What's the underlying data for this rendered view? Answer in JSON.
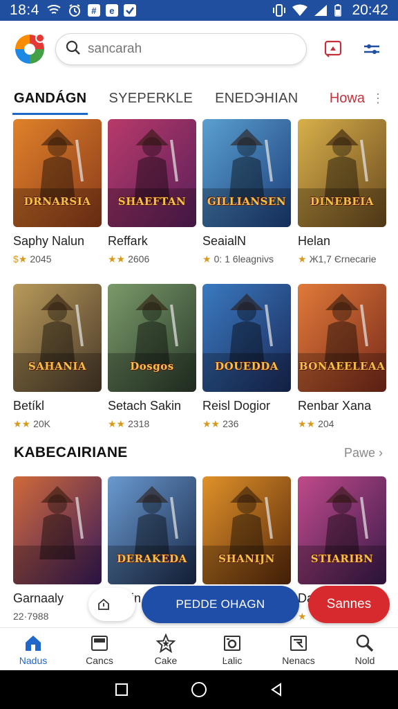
{
  "status_bar": {
    "time_left": "18:4",
    "box_icon_1": "#",
    "box_icon_2": "e",
    "time_right": "20:42"
  },
  "search": {
    "placeholder": "sancarah",
    "value": ""
  },
  "tabs": [
    {
      "label": "GANDÁGN",
      "active": true
    },
    {
      "label": "SYEPERKLE",
      "active": false
    },
    {
      "label": "ENEDЭHIAN",
      "active": false
    }
  ],
  "tab_more": "Howa",
  "grid_rows": [
    [
      {
        "title": "Saphy Nalun",
        "stars": "$★",
        "meta": "2045",
        "art": "DRNARSIA",
        "colors": [
          "#8a3a1a",
          "#e0822a"
        ]
      },
      {
        "title": "Reffark",
        "stars": "★★",
        "meta": "2606",
        "art": "SHAEFTAN",
        "colors": [
          "#5a1f5a",
          "#b83a6a"
        ]
      },
      {
        "title": "SeaialN",
        "stars": "★",
        "meta": "0: 1 6leagnivs",
        "art": "GILLIANSEN",
        "colors": [
          "#1c3e7a",
          "#5aa0d0"
        ]
      },
      {
        "title": "Helan",
        "stars": "★",
        "meta": "Ж1,7 Єrnecarie",
        "art": "DINEBEIA",
        "colors": [
          "#6a4a1f",
          "#d8b04a"
        ]
      }
    ],
    [
      {
        "title": "Betíkl",
        "stars": "★★",
        "meta": "20K",
        "art": "SAHANIA",
        "colors": [
          "#4a3a2a",
          "#b89a5a"
        ]
      },
      {
        "title": "Setach Sakin",
        "stars": "★★",
        "meta": "2318",
        "art": "Dosgos",
        "colors": [
          "#2a3a2a",
          "#7a9a6a"
        ]
      },
      {
        "title": "Reisl Dogior",
        "stars": "★★",
        "meta": "236",
        "art": "DOUEDDA",
        "colors": [
          "#1a2a5a",
          "#3a7ac0"
        ]
      },
      {
        "title": "Renbar Xana",
        "stars": "★★",
        "meta": "204",
        "art": "BONAEELEAA",
        "colors": [
          "#7a2a1a",
          "#e07a3a"
        ]
      }
    ],
    [
      {
        "title": "Garnaaly",
        "stars": "",
        "meta": "22·7988",
        "art": "",
        "colors": [
          "#3a1a5a",
          "#d06a3a"
        ]
      },
      {
        "title": "Oanin",
        "stars": "",
        "meta": "",
        "art": "DERAKEDA",
        "colors": [
          "#1a2a4a",
          "#6a9ad0"
        ]
      },
      {
        "title": "",
        "stars": "",
        "meta": "",
        "art": "SHANIJN",
        "colors": [
          "#5a2a0a",
          "#e0922a"
        ]
      },
      {
        "title": "Dar",
        "stars": "★",
        "meta": "",
        "art": "STIARIBN",
        "colors": [
          "#3a1a4a",
          "#c04a8a"
        ]
      }
    ]
  ],
  "section": {
    "title": "KABECAIRIANE",
    "more": "Pawe"
  },
  "buttons": {
    "primary": "PEDDE OHAGN",
    "secondary": "Sannes"
  },
  "bottom_nav": [
    {
      "label": "Nadus",
      "icon": "home-icon",
      "active": true
    },
    {
      "label": "Cancs",
      "icon": "tablet-icon",
      "active": false
    },
    {
      "label": "Cake",
      "icon": "star-icon",
      "active": false
    },
    {
      "label": "Ŀalic",
      "icon": "camera-icon",
      "active": false
    },
    {
      "label": "Nenacs",
      "icon": "image-icon",
      "active": false
    },
    {
      "label": "Nold",
      "icon": "search-icon",
      "active": false
    }
  ],
  "colors": {
    "status_bar": "#1f4f9e",
    "accent": "#1f67c9",
    "primary_button": "#1f4ea8",
    "secondary_button": "#d62a2e",
    "tab_more": "#c4303a"
  }
}
